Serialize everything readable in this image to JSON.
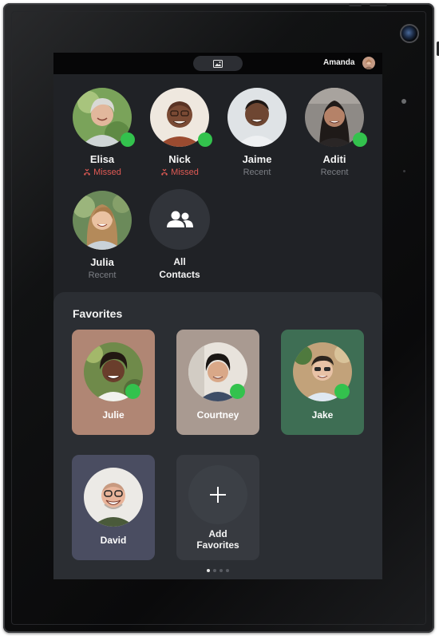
{
  "status_bar": {
    "user_name": "Amanda",
    "media_icon": "image-icon"
  },
  "recents": [
    {
      "name": "Elisa",
      "status": "Missed",
      "missed": true,
      "online": true
    },
    {
      "name": "Nick",
      "status": "Missed",
      "missed": true,
      "online": true
    },
    {
      "name": "Jaime",
      "status": "Recent",
      "missed": false,
      "online": false
    },
    {
      "name": "Aditi",
      "status": "Recent",
      "missed": false,
      "online": true
    },
    {
      "name": "Julia",
      "status": "Recent",
      "missed": false,
      "online": false
    }
  ],
  "all_contacts": {
    "line1": "All",
    "line2": "Contacts",
    "icon": "people-icon"
  },
  "favorites": {
    "title": "Favorites",
    "items": [
      {
        "name": "Julie",
        "color": "#b08674",
        "online": true
      },
      {
        "name": "Courtney",
        "color": "#a99a91",
        "online": true
      },
      {
        "name": "Jake",
        "color": "#3e6e54",
        "online": true
      },
      {
        "name": "David",
        "color": "#4a4d61",
        "online": false
      }
    ],
    "add": {
      "line1": "Add",
      "line2": "Favorites",
      "icon": "plus-icon"
    }
  },
  "pager": {
    "pages": 4,
    "current": 1
  },
  "colors": {
    "online": "#33c24d",
    "missed": "#e05a54",
    "screen_bg": "#202226",
    "panel_bg": "#2b2e33"
  }
}
